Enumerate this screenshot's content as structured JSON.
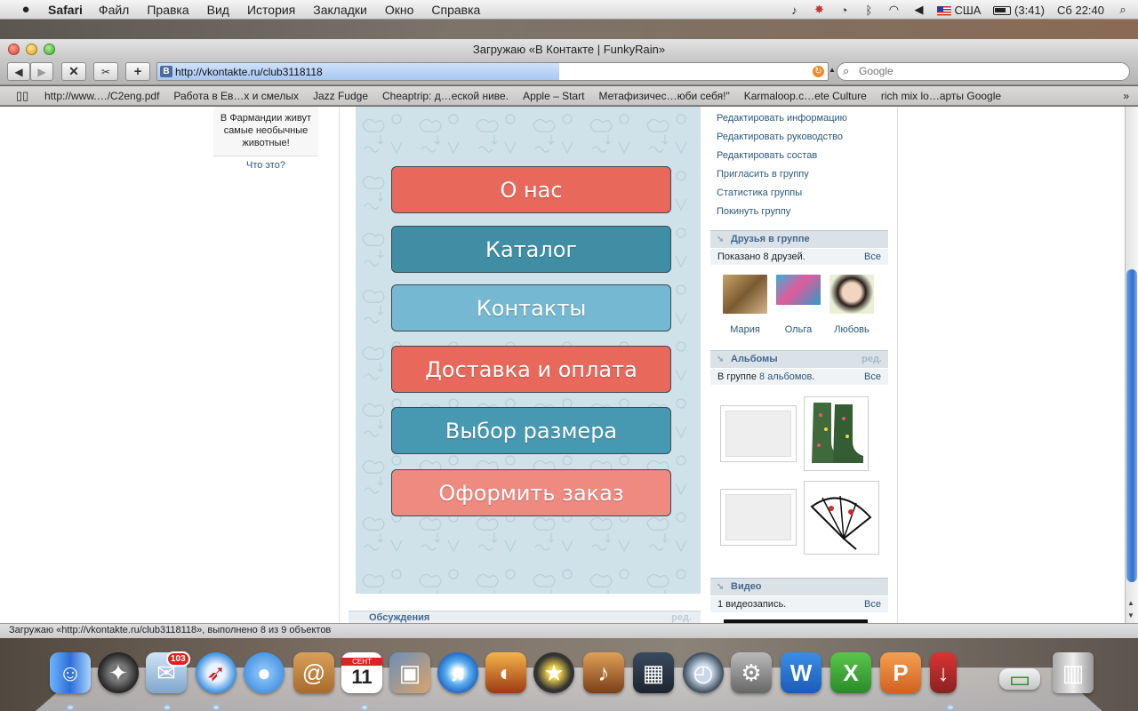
{
  "menubar": {
    "app": "Safari",
    "items": [
      "Файл",
      "Правка",
      "Вид",
      "История",
      "Закладки",
      "Окно",
      "Справка"
    ],
    "input_source": "США",
    "battery": "(3:41)",
    "clock": "Сб 22:40"
  },
  "window": {
    "title": "Загружаю «В Контакте | FunkyRain»"
  },
  "toolbar": {
    "url": "http://vkontakte.ru/club3118118",
    "url_favicon": "В",
    "load_progress": 0.6,
    "search_placeholder": "Google"
  },
  "bookmarks": [
    "http://www.…/C2eng.pdf",
    "Работа в Ев…х и смелых",
    "Jazz Fudge",
    "Cheaptrip: д…еской ниве.",
    "Apple – Start",
    "Метафизичес…юби себя!\"",
    "Karmaloop.c…ete Culture",
    "rich mix lo…арты Google"
  ],
  "bookmarks_more": "»",
  "left": {
    "promo_text": "В Фармандии живут самые необычные животные!",
    "promo_link": "Что это?"
  },
  "wiki_buttons": [
    {
      "label": "О нас",
      "color": "#e8685c"
    },
    {
      "label": "Каталог",
      "color": "#3f8ea4"
    },
    {
      "label": "Контакты",
      "color": "#74b8d1"
    },
    {
      "label": "Доставка и оплата",
      "color": "#e8685c"
    },
    {
      "label": "Выбор размера",
      "color": "#4799b2"
    },
    {
      "label": "Оформить заказ",
      "color": "#ee8a80"
    }
  ],
  "discussions": {
    "title": "Обсуждения",
    "edit": "ред."
  },
  "admin_links": [
    "Редактировать информацию",
    "Редактировать руководство",
    "Редактировать состав",
    "Пригласить в группу",
    "Статистика группы",
    "Покинуть группу"
  ],
  "friends": {
    "title": "Друзья в группе",
    "shown": "Показано 8 друзей.",
    "all": "Все",
    "people": [
      {
        "name": "Мария"
      },
      {
        "name": "Ольга"
      },
      {
        "name": "Любовь"
      }
    ]
  },
  "albums": {
    "title": "Альбомы",
    "edit": "ред.",
    "count_prefix": "В группе ",
    "count_link": "8 альбомов",
    "count_suffix": ".",
    "all": "Все"
  },
  "video": {
    "title": "Видео",
    "count": "1 видеозапись.",
    "all": "Все"
  },
  "statusbar": "Загружаю «http://vkontakte.ru/club3118118», выполнено 8 из 9 объектов",
  "dock": {
    "mail_badge": "103",
    "calendar_month": "СЕНТ",
    "calendar_day": "11"
  },
  "colors": {
    "vk_link": "#2b587a",
    "vk_header": "#45688e",
    "wiki_bg": "#cfe2ea",
    "scroll_thumb": "#2e6fd0"
  }
}
